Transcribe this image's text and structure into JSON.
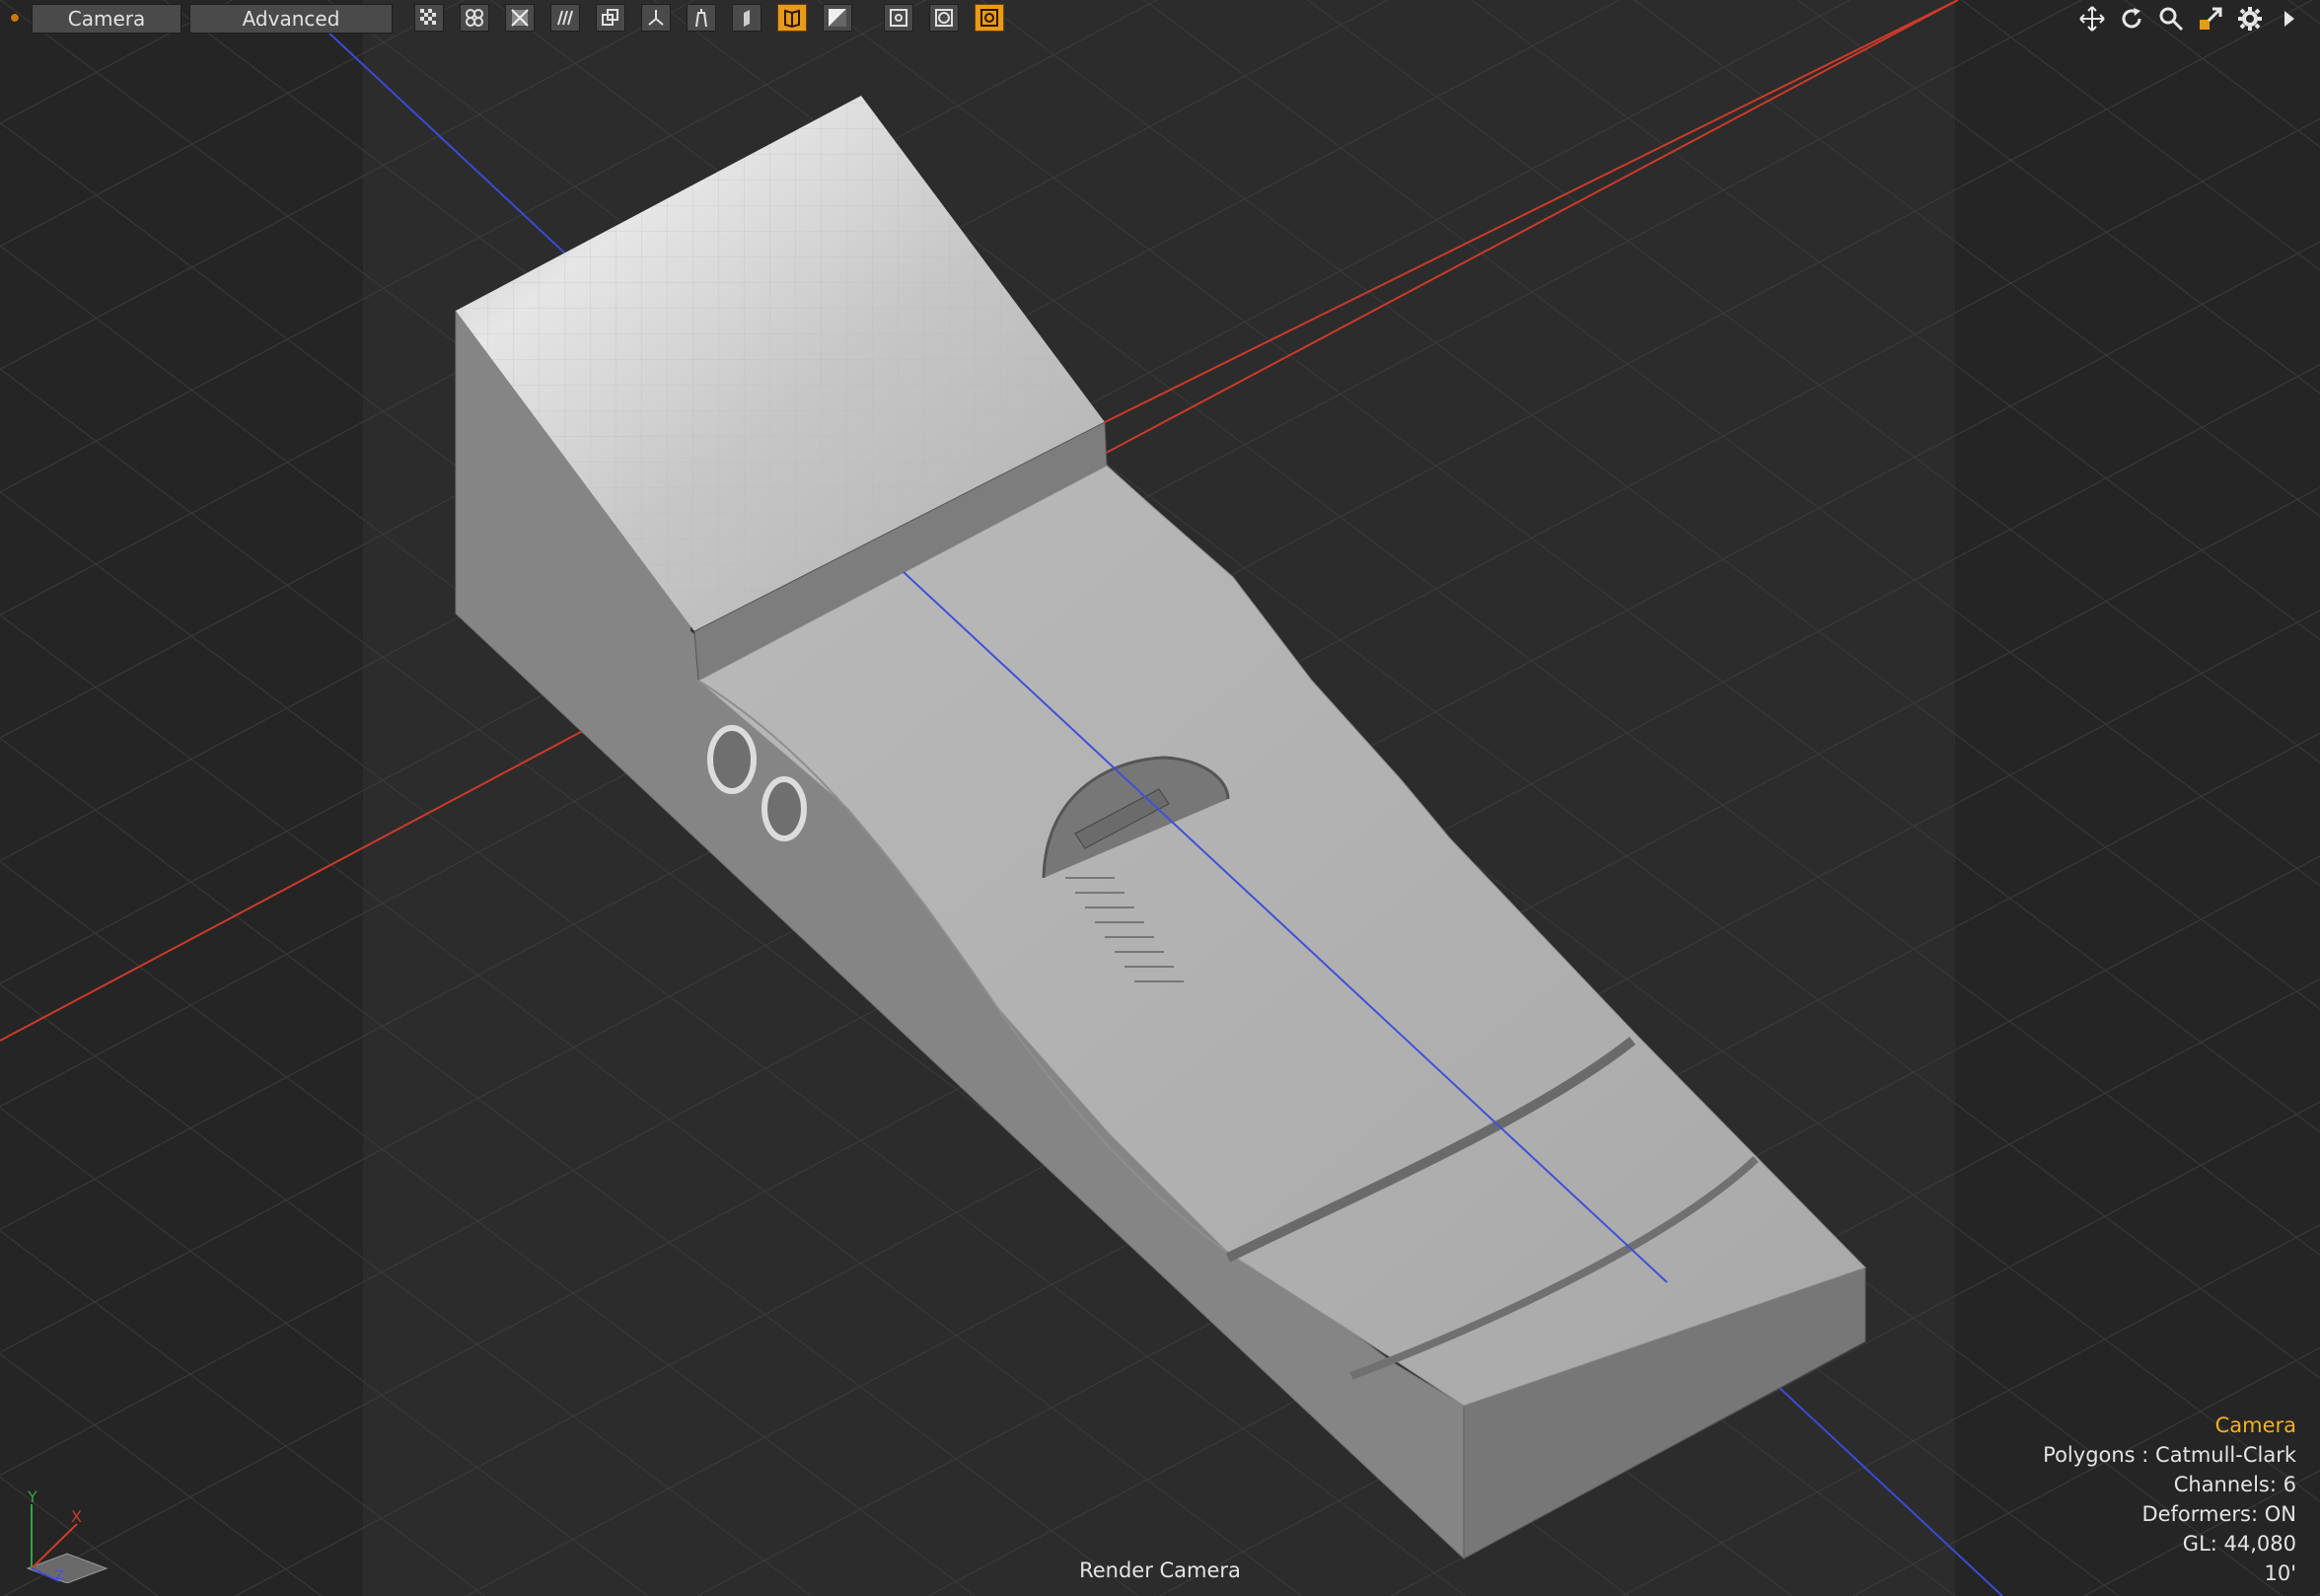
{
  "toolbar": {
    "tabs": [
      {
        "label": "Camera"
      },
      {
        "label": "Advanced"
      }
    ],
    "buttons": [
      {
        "icon": "checker-icon",
        "active": false
      },
      {
        "icon": "four-circles-icon",
        "active": false
      },
      {
        "icon": "cross-box-icon",
        "active": false
      },
      {
        "icon": "waves-icon",
        "active": false
      },
      {
        "icon": "layers-icon",
        "active": false
      },
      {
        "icon": "axis-y-icon",
        "active": false
      },
      {
        "icon": "figure-icon",
        "active": false
      },
      {
        "icon": "leaf-icon",
        "active": false
      },
      {
        "icon": "book-icon",
        "active": true
      },
      {
        "icon": "diagonal-split-icon",
        "active": false
      },
      {
        "icon": "square-target-icon",
        "active": false
      },
      {
        "icon": "circle-target-icon",
        "active": false
      },
      {
        "icon": "refresh-box-icon",
        "active": true
      }
    ]
  },
  "nav": [
    "move-icon",
    "rotate-icon",
    "zoom-icon",
    "fit-icon",
    "gear-icon",
    "play-arrow-icon"
  ],
  "info": {
    "title": "Camera",
    "polygons": "Polygons : Catmull-Clark",
    "channels": "Channels: 6",
    "deformers": "Deformers: ON",
    "gl": "GL: 44,080",
    "scale": "10'"
  },
  "footer": {
    "label": "Render Camera"
  },
  "gizmo": {
    "y": "Y",
    "x": "X",
    "z": "Z"
  },
  "colors": {
    "accent": "#e89a1a",
    "info_title": "#f0b020",
    "axis_x": "#d0402c",
    "axis_z": "#4050d8"
  }
}
